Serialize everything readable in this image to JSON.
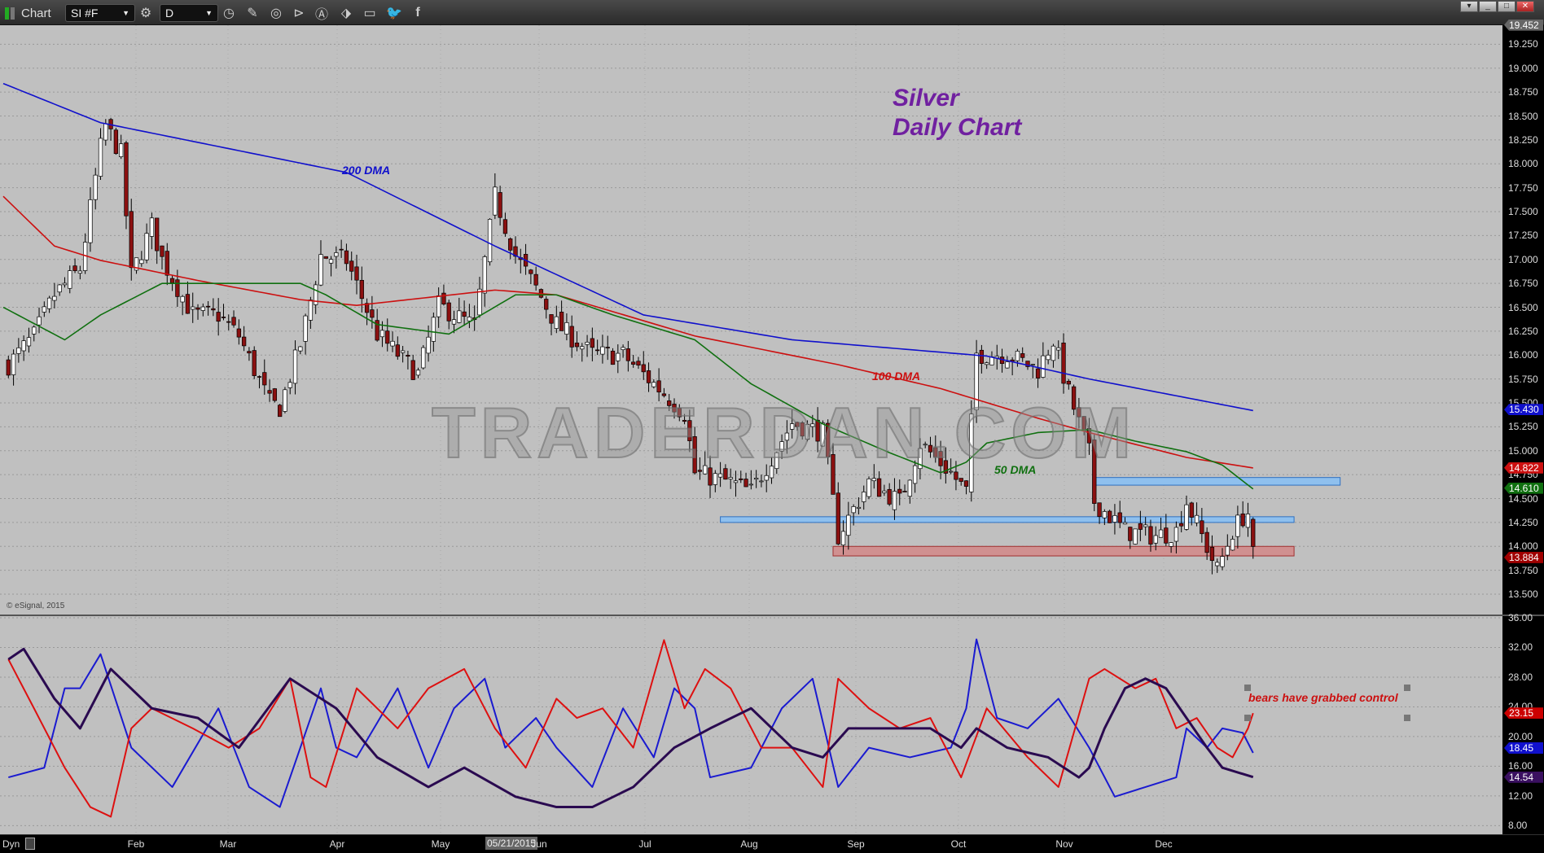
{
  "toolbar": {
    "app_label": "Chart",
    "symbol": "SI #F",
    "interval": "D",
    "icons": [
      "gear-icon",
      "clock-icon",
      "pencil-icon",
      "curve-icon",
      "play-icon",
      "alert-icon",
      "link-icon",
      "comment-icon",
      "twitter-icon",
      "facebook-icon"
    ]
  },
  "window_buttons": [
    "▾",
    "_",
    "□",
    "✕"
  ],
  "colors": {
    "dma200": "#1010cc",
    "dma100": "#cc1010",
    "dma50": "#107010",
    "title": "#7020a0",
    "up": "#ffffff",
    "down": "#8b1010",
    "zone_blue": "#8fc0ee",
    "zone_red": "#d09090"
  },
  "chart_data": [
    {
      "type": "candlestick",
      "title": "Silver",
      "subtitle": "Daily Chart",
      "watermark": "TRADERDAN.COM",
      "credit": "© eSignal, 2015",
      "x_unit": "trading day of 2015",
      "ylim": [
        13.3,
        19.55
      ],
      "yticks": [
        "19.250",
        "19.000",
        "18.750",
        "18.500",
        "18.250",
        "18.000",
        "17.750",
        "17.500",
        "17.250",
        "17.000",
        "16.750",
        "16.500",
        "16.250",
        "16.000",
        "15.750",
        "15.500",
        "15.250",
        "15.000",
        "14.750",
        "14.500",
        "14.250",
        "14.000",
        "13.750",
        "13.500"
      ],
      "last_tags": [
        {
          "value": "19.452",
          "color": "#666666"
        },
        {
          "value": "15.430",
          "color": "#1010cc"
        },
        {
          "value": "14.822",
          "color": "#cc1010"
        },
        {
          "value": "14.610",
          "color": "#107010"
        },
        {
          "value": "13.884",
          "color": "#a00000"
        }
      ],
      "close_path": [
        [
          1,
          15.9
        ],
        [
          6,
          16.2
        ],
        [
          10,
          16.63
        ],
        [
          15,
          16.9
        ],
        [
          19,
          18.17
        ],
        [
          20,
          18.4
        ],
        [
          23,
          18.1
        ],
        [
          25,
          16.83
        ],
        [
          29,
          17.35
        ],
        [
          31,
          17.0
        ],
        [
          37,
          16.42
        ],
        [
          42,
          16.42
        ],
        [
          46,
          16.2
        ],
        [
          52,
          15.5
        ],
        [
          54,
          15.45
        ],
        [
          58,
          16.11
        ],
        [
          62,
          17.04
        ],
        [
          67,
          16.99
        ],
        [
          73,
          16.22
        ],
        [
          81,
          15.8
        ],
        [
          85,
          16.52
        ],
        [
          92,
          16.3
        ],
        [
          96,
          17.66
        ],
        [
          100,
          17.04
        ],
        [
          104,
          16.7
        ],
        [
          108,
          16.32
        ],
        [
          115,
          16.01
        ],
        [
          121,
          16.0
        ],
        [
          125,
          15.8
        ],
        [
          129,
          15.6
        ],
        [
          133,
          15.39
        ],
        [
          135,
          14.77
        ],
        [
          142,
          14.67
        ],
        [
          146,
          14.57
        ],
        [
          154,
          15.29
        ],
        [
          160,
          15.19
        ],
        [
          163,
          14.11
        ],
        [
          169,
          14.67
        ],
        [
          175,
          14.47
        ],
        [
          179,
          15.08
        ],
        [
          185,
          14.77
        ],
        [
          188,
          14.57
        ],
        [
          190,
          16.01
        ],
        [
          196,
          16.01
        ],
        [
          202,
          15.85
        ],
        [
          205,
          16.16
        ],
        [
          208,
          15.6
        ],
        [
          212,
          14.98
        ],
        [
          213,
          14.47
        ],
        [
          219,
          14.16
        ],
        [
          225,
          14.11
        ],
        [
          229,
          14.16
        ],
        [
          231,
          14.47
        ],
        [
          234,
          14.11
        ],
        [
          237,
          13.75
        ],
        [
          240,
          14.16
        ],
        [
          242,
          14.31
        ],
        [
          243,
          14.35
        ],
        [
          244,
          13.9
        ]
      ],
      "series": [
        {
          "name": "200 DMA",
          "points": [
            [
              0,
              18.84
            ],
            [
              19,
              18.43
            ],
            [
              67,
              17.91
            ],
            [
              96,
              17.14
            ],
            [
              125,
              16.42
            ],
            [
              154,
              16.16
            ],
            [
              192,
              15.99
            ],
            [
              212,
              15.75
            ],
            [
              244,
              15.42
            ]
          ]
        },
        {
          "name": "100 DMA",
          "points": [
            [
              0,
              17.66
            ],
            [
              10,
              17.14
            ],
            [
              19,
              16.99
            ],
            [
              38,
              16.78
            ],
            [
              58,
              16.58
            ],
            [
              69,
              16.52
            ],
            [
              96,
              16.68
            ],
            [
              108,
              16.63
            ],
            [
              135,
              16.2
            ],
            [
              163,
              15.9
            ],
            [
              183,
              15.65
            ],
            [
              202,
              15.34
            ],
            [
              212,
              15.19
            ],
            [
              231,
              14.93
            ],
            [
              244,
              14.82
            ]
          ]
        },
        {
          "name": "50 DMA",
          "points": [
            [
              0,
              16.5
            ],
            [
              12,
              16.16
            ],
            [
              19,
              16.42
            ],
            [
              31,
              16.75
            ],
            [
              58,
              16.75
            ],
            [
              63,
              16.63
            ],
            [
              73,
              16.32
            ],
            [
              87,
              16.22
            ],
            [
              100,
              16.63
            ],
            [
              108,
              16.63
            ],
            [
              119,
              16.42
            ],
            [
              135,
              16.16
            ],
            [
              146,
              15.7
            ],
            [
              160,
              15.28
            ],
            [
              173,
              14.98
            ],
            [
              183,
              14.77
            ],
            [
              188,
              14.88
            ],
            [
              192,
              15.08
            ],
            [
              202,
              15.19
            ],
            [
              212,
              15.22
            ],
            [
              221,
              15.1
            ],
            [
              231,
              14.99
            ],
            [
              238,
              14.85
            ],
            [
              244,
              14.6
            ]
          ]
        }
      ],
      "zones": [
        {
          "color": "blue",
          "from": 14.64,
          "to": 14.72,
          "start": 213,
          "end": 261
        },
        {
          "color": "blue",
          "from": 14.25,
          "to": 14.31,
          "start": 140,
          "end": 252
        },
        {
          "color": "red",
          "from": 13.9,
          "to": 14.0,
          "start": 162,
          "end": 252
        }
      ],
      "labels": {
        "dma200": "200 DMA",
        "dma100": "100 DMA",
        "dma50": "50 DMA"
      }
    },
    {
      "type": "line",
      "ylim": [
        8,
        36
      ],
      "yticks": [
        "36.00",
        "32.00",
        "28.00",
        "24.00",
        "20.00",
        "16.00",
        "12.00",
        "8.00"
      ],
      "last_tags": [
        {
          "value": "23.15",
          "color": "#cc0000"
        },
        {
          "value": "18.45",
          "color": "#1010cc"
        },
        {
          "value": "14.54",
          "color": "#3a1060"
        }
      ],
      "annotation": "bears have grabbed control",
      "series": [
        {
          "name": "blue",
          "color": "#1a1ad0",
          "points": [
            [
              1,
              14.5
            ],
            [
              8,
              15.8
            ],
            [
              12,
              26.5
            ],
            [
              15,
              26.5
            ],
            [
              19,
              31.1
            ],
            [
              25,
              18.5
            ],
            [
              33,
              13.2
            ],
            [
              42,
              23.8
            ],
            [
              48,
              13.2
            ],
            [
              54,
              10.5
            ],
            [
              58,
              18.5
            ],
            [
              62,
              26.5
            ],
            [
              65,
              18.5
            ],
            [
              69,
              17.2
            ],
            [
              77,
              26.5
            ],
            [
              83,
              15.8
            ],
            [
              88,
              23.8
            ],
            [
              94,
              27.8
            ],
            [
              98,
              18.5
            ],
            [
              104,
              22.5
            ],
            [
              108,
              18.5
            ],
            [
              115,
              13.2
            ],
            [
              121,
              23.8
            ],
            [
              127,
              17.2
            ],
            [
              131,
              26.5
            ],
            [
              135,
              23.8
            ],
            [
              138,
              14.5
            ],
            [
              146,
              15.8
            ],
            [
              152,
              23.8
            ],
            [
              158,
              27.8
            ],
            [
              163,
              13.2
            ],
            [
              169,
              18.5
            ],
            [
              177,
              17.2
            ],
            [
              185,
              18.5
            ],
            [
              188,
              23.8
            ],
            [
              190,
              33.1
            ],
            [
              194,
              22.5
            ],
            [
              200,
              21.1
            ],
            [
              206,
              25.1
            ],
            [
              212,
              18.5
            ],
            [
              217,
              11.9
            ],
            [
              223,
              13.2
            ],
            [
              229,
              14.5
            ],
            [
              231,
              21.1
            ],
            [
              235,
              18.5
            ],
            [
              238,
              21.1
            ],
            [
              242,
              20.5
            ],
            [
              244,
              17.8
            ]
          ]
        },
        {
          "name": "red",
          "color": "#dd1010",
          "points": [
            [
              1,
              30.4
            ],
            [
              6,
              23.8
            ],
            [
              12,
              15.8
            ],
            [
              17,
              10.5
            ],
            [
              21,
              9.2
            ],
            [
              25,
              21.1
            ],
            [
              29,
              23.8
            ],
            [
              37,
              21.1
            ],
            [
              44,
              18.5
            ],
            [
              50,
              21.1
            ],
            [
              56,
              27.8
            ],
            [
              60,
              14.5
            ],
            [
              63,
              13.2
            ],
            [
              69,
              26.5
            ],
            [
              77,
              21.1
            ],
            [
              83,
              26.5
            ],
            [
              90,
              29.1
            ],
            [
              96,
              21.1
            ],
            [
              102,
              15.8
            ],
            [
              108,
              25.1
            ],
            [
              112,
              22.5
            ],
            [
              117,
              23.8
            ],
            [
              123,
              18.5
            ],
            [
              129,
              33.0
            ],
            [
              133,
              23.8
            ],
            [
              137,
              29.1
            ],
            [
              142,
              26.5
            ],
            [
              148,
              18.5
            ],
            [
              154,
              18.5
            ],
            [
              160,
              13.2
            ],
            [
              163,
              27.8
            ],
            [
              169,
              23.8
            ],
            [
              175,
              21.1
            ],
            [
              181,
              22.5
            ],
            [
              187,
              14.5
            ],
            [
              192,
              23.8
            ],
            [
              200,
              17.2
            ],
            [
              206,
              13.2
            ],
            [
              212,
              27.8
            ],
            [
              215,
              29.1
            ],
            [
              221,
              26.5
            ],
            [
              225,
              27.8
            ],
            [
              229,
              21.1
            ],
            [
              233,
              22.5
            ],
            [
              237,
              18.5
            ],
            [
              240,
              17.2
            ],
            [
              243,
              21.1
            ],
            [
              244,
              23.15
            ]
          ]
        },
        {
          "name": "purple",
          "color": "#2a0a50",
          "points": [
            [
              1,
              30.4
            ],
            [
              4,
              31.8
            ],
            [
              10,
              25.1
            ],
            [
              15,
              21.1
            ],
            [
              21,
              29.1
            ],
            [
              29,
              23.8
            ],
            [
              38,
              22.5
            ],
            [
              46,
              18.5
            ],
            [
              56,
              27.8
            ],
            [
              65,
              23.8
            ],
            [
              73,
              17.2
            ],
            [
              83,
              13.2
            ],
            [
              90,
              15.8
            ],
            [
              100,
              11.9
            ],
            [
              108,
              10.5
            ],
            [
              115,
              10.5
            ],
            [
              123,
              13.2
            ],
            [
              131,
              18.5
            ],
            [
              138,
              21.1
            ],
            [
              146,
              23.8
            ],
            [
              154,
              18.5
            ],
            [
              160,
              17.2
            ],
            [
              165,
              21.1
            ],
            [
              173,
              21.1
            ],
            [
              181,
              21.1
            ],
            [
              187,
              18.5
            ],
            [
              190,
              21.1
            ],
            [
              196,
              18.5
            ],
            [
              204,
              17.2
            ],
            [
              210,
              14.5
            ],
            [
              212,
              15.8
            ],
            [
              215,
              21.1
            ],
            [
              219,
              26.5
            ],
            [
              223,
              27.8
            ],
            [
              227,
              26.5
            ],
            [
              231,
              22.5
            ],
            [
              235,
              18.5
            ],
            [
              238,
              15.8
            ],
            [
              244,
              14.54
            ]
          ]
        }
      ]
    }
  ],
  "time_axis": {
    "dyn_label": "Dyn",
    "cursor_date": "05/21/2015",
    "months": [
      "Feb",
      "Mar",
      "Apr",
      "May",
      "Jun",
      "Jul",
      "Aug",
      "Sep",
      "Oct",
      "Nov",
      "Dec"
    ]
  }
}
